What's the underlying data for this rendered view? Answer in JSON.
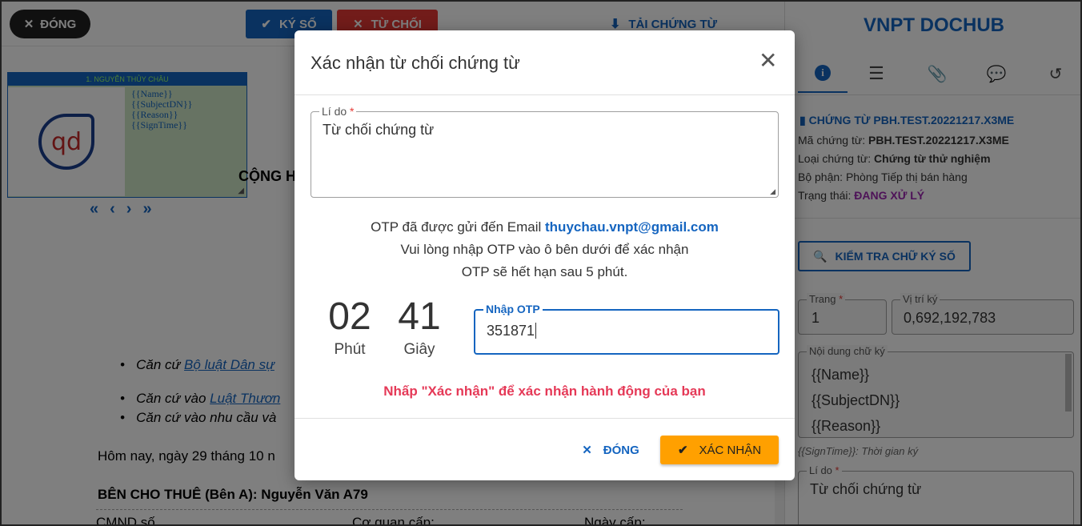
{
  "toolbar": {
    "close_label": "ĐÓNG",
    "sign_label": "KÝ SỐ",
    "reject_label": "TỪ CHỐI",
    "download_label": "TẢI CHỨNG TỪ"
  },
  "signature_box": {
    "header": "1. NGUYỄN THỦY CHÂU",
    "placeholders": [
      "{{Name}}",
      "{{SubjectDN}}",
      "{{Reason}}",
      "{{SignTime}}"
    ],
    "logo_text": "qd"
  },
  "pager": {
    "first": "«",
    "prev": "‹",
    "next": "›",
    "last": "»"
  },
  "document": {
    "heading_fragment": "CỘNG H",
    "bullets": [
      {
        "prefix": "Căn cứ ",
        "link": "Bộ luật Dân sự"
      },
      {
        "prefix": "Căn cứ vào ",
        "link": "Luật Thươn"
      },
      {
        "prefix": "Căn cứ vào nhu cầu và",
        "link": ""
      }
    ],
    "today": "Hôm nay, ngày 29 tháng 10 n",
    "party_a": "BÊN CHO THUÊ (Bên A): Nguyễn Văn A79",
    "row_cmnd": "CMND số",
    "row_agency": "Cơ quan cấp:",
    "row_date": "Ngày cấp:"
  },
  "sidebar": {
    "app_title": "VNPT DOCHUB",
    "tabs": [
      "info-icon",
      "list-icon",
      "attachment-icon",
      "comments-icon",
      "history-icon"
    ],
    "doc_title": "CHỨNG TỪ PBH.TEST.20221217.X3ME",
    "code_label": "Mã chứng từ: ",
    "code_value": "PBH.TEST.20221217.X3ME",
    "type_label": "Loại chứng từ: ",
    "type_value": "Chứng từ thử nghiệm",
    "dept_label": "Bộ phận: ",
    "dept_value": "Phòng Tiếp thị bán hàng",
    "status_label": "Trạng thái: ",
    "status_value": "ĐANG XỬ LÝ",
    "check_signature_label": "KIỂM TRA CHỮ KÝ SỐ",
    "page_label": "Trang",
    "page_value": "1",
    "position_label": "Vị trí ký",
    "position_value": "0,692,192,783",
    "content_label": "Nội dung chữ ký",
    "content_lines": [
      "{{Name}}",
      "{{SubjectDN}}",
      "{{Reason}}"
    ],
    "signtime_hint": "{{SignTime}}: Thời gian ký",
    "reason_label": "Lí do",
    "reason_value": "Từ chối chứng từ",
    "required_mark": "*"
  },
  "modal": {
    "title": "Xác nhận từ chối chứng từ",
    "reason_label": "Lí do",
    "required_mark": "*",
    "reason_value": "Từ chối chứng từ",
    "otp_line1_prefix": "OTP đã được gửi đến Email ",
    "otp_email": "thuychau.vnpt@gmail.com",
    "otp_line2": "Vui lòng nhập OTP vào ô bên dưới để xác nhận",
    "otp_line3": "OTP sẽ hết hạn sau 5 phút.",
    "minutes": "02",
    "minutes_label": "Phút",
    "seconds": "41",
    "seconds_label": "Giây",
    "otp_label": "Nhập OTP",
    "otp_value": "351871",
    "hint": "Nhấp \"Xác nhận\" để xác nhận hành động của bạn",
    "close_label": "ĐÓNG",
    "confirm_label": "XÁC NHẬN"
  },
  "colors": {
    "primary": "#1565c0",
    "danger": "#e53935",
    "confirm": "#ffa000",
    "status": "#9c27b0",
    "hint": "#e53957"
  }
}
